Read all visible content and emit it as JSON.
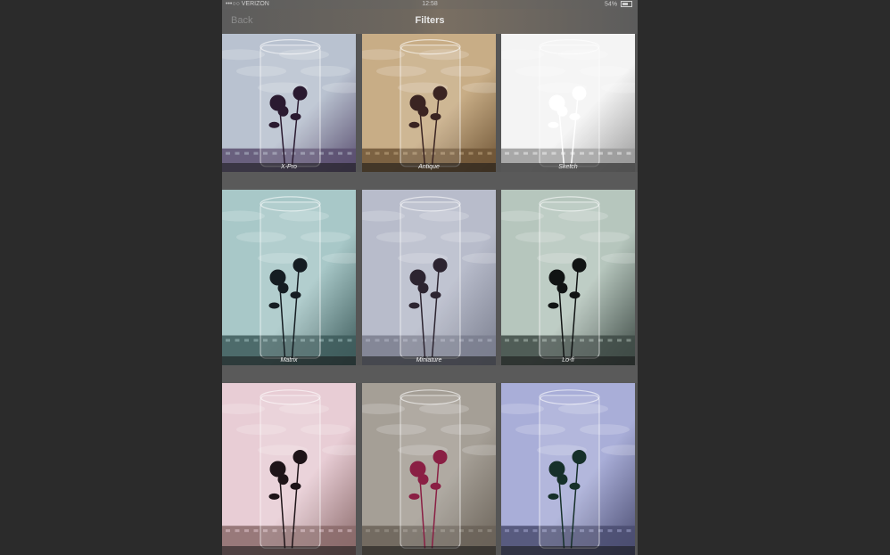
{
  "status_bar": {
    "carrier": "•••○○ VERIZON",
    "time": "12:58",
    "battery": "54%"
  },
  "nav": {
    "back_label": "Back",
    "title": "Filters"
  },
  "filters": [
    {
      "label": "X-Pro",
      "sky": "#b9c2d0",
      "tint": "#5a4f70",
      "flower": "#2a1a30"
    },
    {
      "label": "Antique",
      "sky": "#c8ad86",
      "tint": "#6f5536",
      "flower": "#3a2422"
    },
    {
      "label": "Sketch",
      "sky": "#f4f4f4",
      "tint": "#9a9a9a",
      "flower": "#ffffff"
    },
    {
      "label": "Matrix",
      "sky": "#a8c8c8",
      "tint": "#3d5a5a",
      "flower": "#151d22"
    },
    {
      "label": "Miniature",
      "sky": "#b8bccb",
      "tint": "#7a7e8e",
      "flower": "#2c2430"
    },
    {
      "label": "Lo-fi",
      "sky": "#b6c6bd",
      "tint": "#3e4a45",
      "flower": "#111414"
    },
    {
      "label": "",
      "sky": "#e8cdd5",
      "tint": "#8a6a6a",
      "flower": "#1e1418"
    },
    {
      "label": "",
      "sky": "#a59f96",
      "tint": "#6a6258",
      "flower": "#8a1f44"
    },
    {
      "label": "",
      "sky": "#a9aed8",
      "tint": "#4a4c70",
      "flower": "#16302a"
    }
  ]
}
